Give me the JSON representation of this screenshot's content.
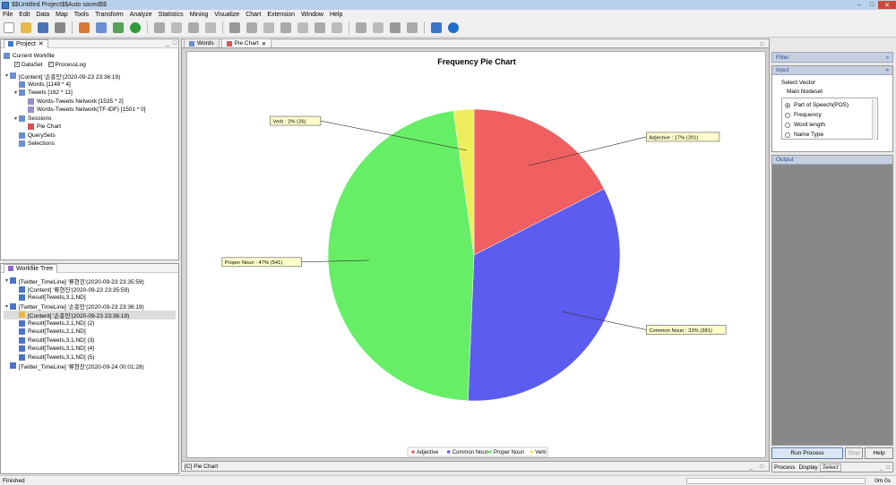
{
  "window": {
    "title": "$$Untitled Project$$Auto saved$$"
  },
  "menu": [
    "File",
    "Edit",
    "Data",
    "Map",
    "Tools",
    "Transform",
    "Analyze",
    "Statistics",
    "Mining",
    "Visualize",
    "Chart",
    "Extension",
    "Window",
    "Help"
  ],
  "project_panel": {
    "tab": "Project",
    "current_workfile": "Current Workfile",
    "dataset_label": "DataSet",
    "processlog_label": "ProcessLog",
    "items": [
      {
        "label": "[Content] '손흥민'(2020-09-23 23:36:19)",
        "level": 0,
        "toggle": "▾"
      },
      {
        "label": "Words [1149 * 4]",
        "level": 1,
        "toggle": ""
      },
      {
        "label": "Tweets [162 * 11]",
        "level": 1,
        "toggle": "▾"
      },
      {
        "label": "Words-Tweets Network [1535 * 2]",
        "level": 2,
        "toggle": ""
      },
      {
        "label": "Words-Tweets Network(TF-IDF) [1501 * 0]",
        "level": 2,
        "toggle": ""
      },
      {
        "label": "Sessions",
        "level": 1,
        "toggle": "▾"
      },
      {
        "label": "Pie Chart",
        "level": 2,
        "toggle": ""
      },
      {
        "label": "QuerySets",
        "level": 1,
        "toggle": ""
      },
      {
        "label": "Selections",
        "level": 1,
        "toggle": ""
      }
    ]
  },
  "workflow_panel": {
    "tab": "Workfile Tree",
    "items": [
      {
        "label": "[Twitter_TimeLine] '류현진'(2020-09-23 23:35:59)",
        "level": 0,
        "toggle": "▾",
        "sel": false
      },
      {
        "label": "[Content] '류현진'(2020-09-23 23:35:59)",
        "level": 1,
        "toggle": "",
        "sel": false
      },
      {
        "label": "Result[Tweets,3,1,ND]",
        "level": 1,
        "toggle": "",
        "sel": false
      },
      {
        "label": "[Twitter_TimeLine] '손흥민'(2020-09-23 23:36:19)",
        "level": 0,
        "toggle": "▾",
        "sel": false
      },
      {
        "label": "[Content] '손흥민'(2020-09-23 23:36:19)",
        "level": 1,
        "toggle": "",
        "sel": true
      },
      {
        "label": "Result[Tweets,2,1,ND] (2)",
        "level": 1,
        "toggle": "",
        "sel": false
      },
      {
        "label": "Result[Tweets,2,1,ND]",
        "level": 1,
        "toggle": "",
        "sel": false
      },
      {
        "label": "Result[Tweets,3,1,ND] (3)",
        "level": 1,
        "toggle": "",
        "sel": false
      },
      {
        "label": "Result[Tweets,3,1,ND] (4)",
        "level": 1,
        "toggle": "",
        "sel": false
      },
      {
        "label": "Result[Tweets,3,1,ND] (5)",
        "level": 1,
        "toggle": "",
        "sel": false
      },
      {
        "label": "[Twitter_TimeLine] '류현진'(2020-09-24 00:01:28)",
        "level": 0,
        "toggle": "",
        "sel": false
      }
    ]
  },
  "editor": {
    "tabs": [
      "Words",
      "Pie Chart"
    ],
    "bottom_label": "[C] Pie Chart"
  },
  "chart_data": {
    "type": "pie",
    "title": "Frequency Pie Chart",
    "categories": [
      "Adjective",
      "Common Noun",
      "Proper Noun",
      "Verb"
    ],
    "values": [
      201,
      381,
      541,
      26
    ],
    "percent_labels": [
      "Adjective : 17% (201)",
      "Common Noun : 33% (381)",
      "Proper Noun : 47% (541)",
      "Verb : 2% (26)"
    ],
    "colors": [
      "#f06060",
      "#5c5cee",
      "#66ee66",
      "#eeee5c"
    ],
    "legend_position": "bottom"
  },
  "right_panel": {
    "filter_title": "Filter",
    "input_title": "Input",
    "select_vector": "Select Vector",
    "main_nodeset": "Main Nodeset",
    "options": [
      "Part of Speech(POS)",
      "Frequency",
      "Word length",
      "Name Type"
    ],
    "selected_option": 0,
    "output_title": "Output",
    "run_button": "Run Process",
    "stop_button": "Stop",
    "help_button": "Help",
    "bottom_tabs": [
      "Process",
      "Display",
      "Select"
    ]
  },
  "status": {
    "left": "Finished",
    "right": "0m 0s"
  }
}
